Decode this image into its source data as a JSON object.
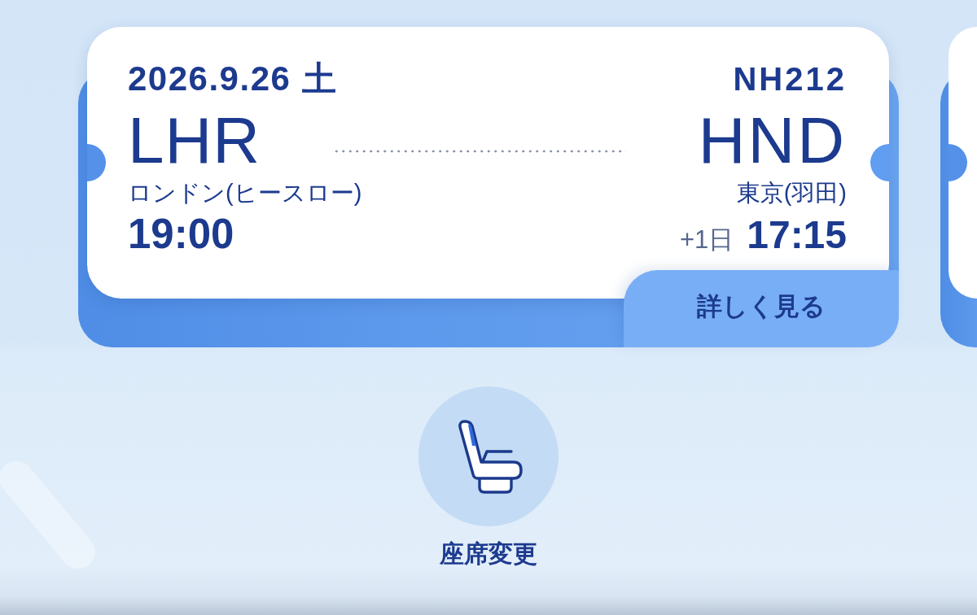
{
  "ticket": {
    "date": "2026.9.26 土",
    "flight_number": "NH212",
    "departure": {
      "code": "LHR",
      "airport": "ロンドン(ヒースロー)",
      "time": "19:00"
    },
    "arrival": {
      "code": "HND",
      "airport": "東京(羽田)",
      "day_offset": "+1日",
      "time": "17:15"
    },
    "details_button": {
      "label": "詳しく見る"
    }
  },
  "seat_change": {
    "label": "座席変更"
  }
}
